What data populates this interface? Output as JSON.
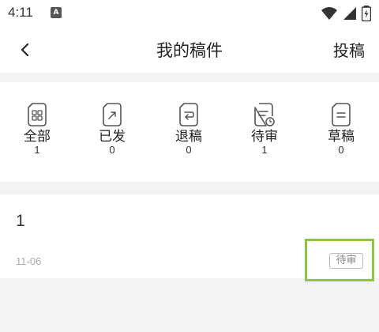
{
  "status_bar": {
    "time": "4:11",
    "app_icon": "A"
  },
  "header": {
    "back_icon": "chevron-left-icon",
    "title": "我的稿件",
    "submit_label": "投稿"
  },
  "tabs": [
    {
      "label": "全部",
      "count": "1",
      "icon": "grid-document-icon"
    },
    {
      "label": "已发",
      "count": "0",
      "icon": "sent-document-icon"
    },
    {
      "label": "退稿",
      "count": "0",
      "icon": "returned-document-icon"
    },
    {
      "label": "待审",
      "count": "1",
      "icon": "pending-document-icon"
    },
    {
      "label": "草稿",
      "count": "0",
      "icon": "draft-document-icon"
    }
  ],
  "manuscripts": [
    {
      "title": "1",
      "date": "11-06",
      "status": "待审"
    }
  ],
  "colors": {
    "highlight": "#8cc63e",
    "background": "#f4f4f4",
    "surface": "#ffffff"
  }
}
